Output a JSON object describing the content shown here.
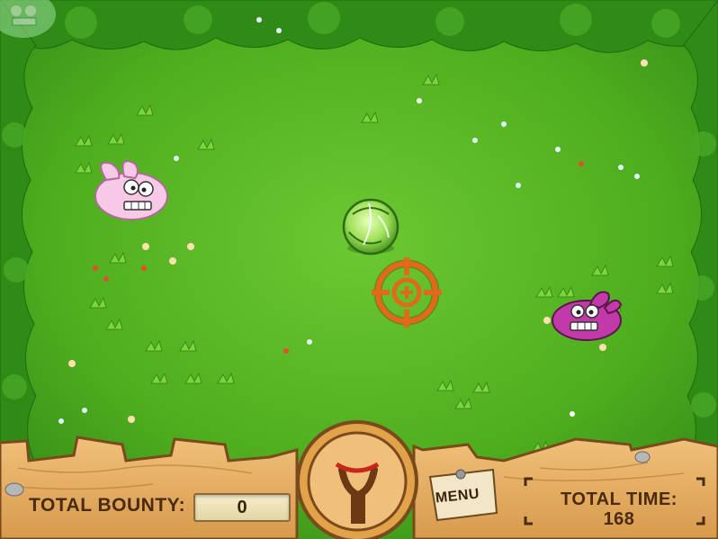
{
  "hud": {
    "bounty_label": "TOTAL BOUNTY:",
    "bounty_value": "0",
    "time_label": "TOTAL TIME:",
    "time_value": "168",
    "menu_label": "MENU"
  },
  "colors": {
    "grass": "#4fae1e",
    "hedge": "#2f8a16",
    "fence": "#e0a85a",
    "fence_dark": "#7a4a1c",
    "crosshair": "#e06a1a",
    "text": "#4a2b0c"
  },
  "icons": {
    "crosshair": "crosshair-icon",
    "slingshot": "slingshot-icon",
    "cabbage": "cabbage-icon"
  }
}
